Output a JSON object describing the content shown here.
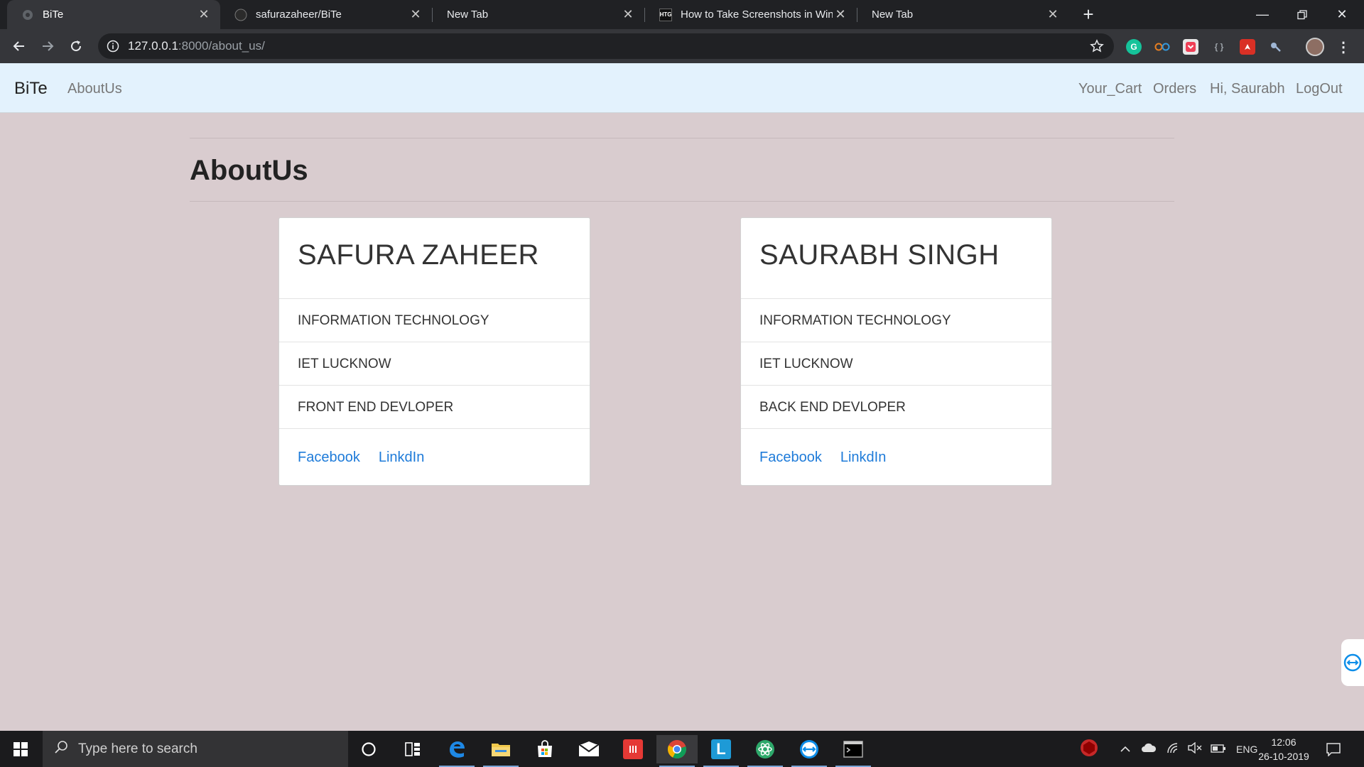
{
  "browser": {
    "tabs": [
      {
        "title": "BiTe",
        "active": true
      },
      {
        "title": "safurazaheer/BiTe",
        "active": false
      },
      {
        "title": "New Tab",
        "active": false
      },
      {
        "title": "How to Take Screenshots in Wind",
        "active": false
      },
      {
        "title": "New Tab",
        "active": false
      }
    ],
    "url_host": "127.0.0.1",
    "url_rest": ":8000/about_us/",
    "favicon_htg": "HTG"
  },
  "site": {
    "brand": "BiTe",
    "nav_left": [
      "AboutUs"
    ],
    "nav_right": [
      "Your_Cart",
      "Orders",
      "Hi, Saurabh",
      "LogOut"
    ],
    "page_title": "AboutUs",
    "members": [
      {
        "name": "SAFURA ZAHEER",
        "branch": "INFORMATION TECHNOLOGY",
        "college": "IET LUCKNOW",
        "role": "FRONT END DEVLOPER",
        "links": [
          "Facebook",
          "LinkdIn"
        ]
      },
      {
        "name": "SAURABH SINGH",
        "branch": "INFORMATION TECHNOLOGY",
        "college": "IET LUCKNOW",
        "role": "BACK END DEVLOPER",
        "links": [
          "Facebook",
          "LinkdIn"
        ]
      }
    ]
  },
  "taskbar": {
    "search_placeholder": "Type here to search",
    "language": "ENG",
    "time": "12:06",
    "date": "26-10-2019",
    "app_letter": "L"
  },
  "colors": {
    "page_bg": "#d9cccf",
    "navbar_bg": "#e3f2fd",
    "link": "#1e7bd9"
  }
}
